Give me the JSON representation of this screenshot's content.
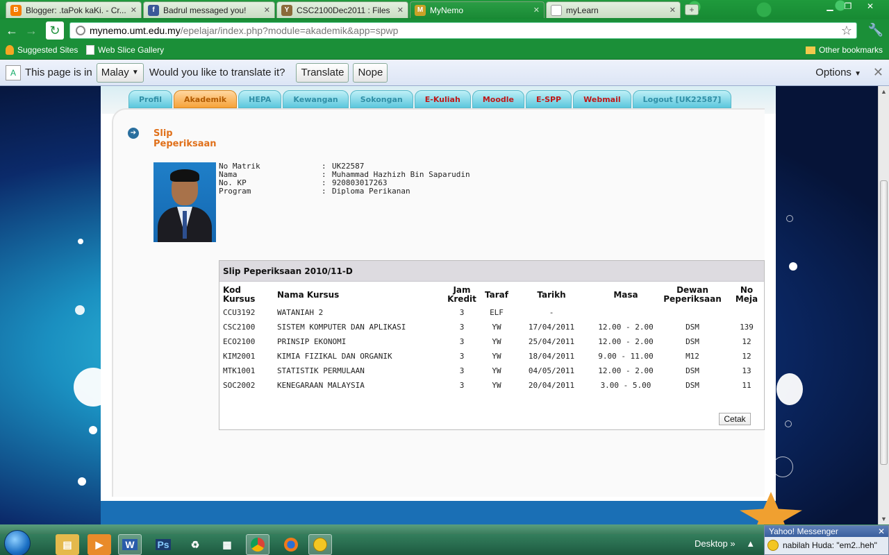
{
  "browser": {
    "tabs": [
      {
        "title": "Blogger: .taPok kaKi. - Cr...",
        "favicon_color": "#f57d00",
        "favicon": "B"
      },
      {
        "title": "Badrul messaged you!",
        "favicon_color": "#3b5998",
        "favicon": "f"
      },
      {
        "title": "CSC2100Dec2011 : Files",
        "favicon_color": "#8a6b3a",
        "favicon": "Y"
      },
      {
        "title": "MyNemo",
        "favicon_color": "#c9a227",
        "favicon": "M"
      },
      {
        "title": "myLearn",
        "favicon_color": "#ffffff",
        "favicon": ""
      }
    ],
    "active_tab": 3,
    "url_host": "mynemo.umt.edu.my",
    "url_path": "/epelajar/index.php?module=akademik&app=spwp",
    "bookmarks": {
      "suggested": "Suggested Sites",
      "webslice": "Web Slice Gallery",
      "other": "Other bookmarks"
    }
  },
  "translate_bar": {
    "prefix": "This page is in",
    "language": "Malay",
    "question": "Would you like to translate it?",
    "translate_label": "Translate",
    "nope_label": "Nope",
    "options_label": "Options"
  },
  "site": {
    "nav": [
      "Profil",
      "Akademik",
      "HEPA",
      "Kewangan",
      "Sokongan",
      "E-Kuliah",
      "Moodle",
      "E-SPP",
      "Webmail",
      "Logout [UK22587]"
    ],
    "active_nav": "Akademik",
    "page_title_line1": "Slip",
    "page_title_line2": "Peperiksaan"
  },
  "student": {
    "fields": [
      {
        "label": "No Matrik",
        "value": "UK22587"
      },
      {
        "label": "Nama",
        "value": "Muhammad Hazhizh Bin Saparudin"
      },
      {
        "label": "No. KP",
        "value": "920803017263"
      },
      {
        "label": "Program",
        "value": "Diploma Perikanan"
      }
    ]
  },
  "slip": {
    "title": "Slip Peperiksaan 2010/11-D",
    "headers": {
      "kod_1": "Kod",
      "kod_2": "Kursus",
      "nama": "Nama Kursus",
      "jam_1": "Jam",
      "jam_2": "Kredit",
      "taraf": "Taraf",
      "tarikh": "Tarikh",
      "masa": "Masa",
      "dewan_1": "Dewan",
      "dewan_2": "Peperiksaan",
      "meja_1": "No",
      "meja_2": "Meja"
    },
    "rows": [
      {
        "kod": "CCU3192",
        "nama": "WATANIAH 2",
        "jam": "3",
        "taraf": "ELF",
        "tarikh": "-",
        "masa": "",
        "dewan": "",
        "meja": ""
      },
      {
        "kod": "CSC2100",
        "nama": "SISTEM KOMPUTER DAN APLIKASI",
        "jam": "3",
        "taraf": "YW",
        "tarikh": "17/04/2011",
        "masa": "12.00 - 2.00",
        "dewan": "DSM",
        "meja": "139"
      },
      {
        "kod": "ECO2100",
        "nama": "PRINSIP EKONOMI",
        "jam": "3",
        "taraf": "YW",
        "tarikh": "25/04/2011",
        "masa": "12.00 - 2.00",
        "dewan": "DSM",
        "meja": "12"
      },
      {
        "kod": "KIM2001",
        "nama": "KIMIA FIZIKAL DAN ORGANIK",
        "jam": "3",
        "taraf": "YW",
        "tarikh": "18/04/2011",
        "masa": "9.00 - 11.00",
        "dewan": "M12",
        "meja": "12"
      },
      {
        "kod": "MTK1001",
        "nama": "STATISTIK PERMULAAN",
        "jam": "3",
        "taraf": "YW",
        "tarikh": "04/05/2011",
        "masa": "12.00 - 2.00",
        "dewan": "DSM",
        "meja": "13"
      },
      {
        "kod": "SOC2002",
        "nama": "KENEGARAAN MALAYSIA",
        "jam": "3",
        "taraf": "YW",
        "tarikh": "20/04/2011",
        "masa": "3.00 - 5.00",
        "dewan": "DSM",
        "meja": "11"
      }
    ],
    "print_label": "Cetak"
  },
  "taskbar": {
    "desktop_label": "Desktop",
    "messenger_title": "Yahoo! Messenger",
    "messenger_text": "nabilah Huda: \"em2..heh\""
  }
}
